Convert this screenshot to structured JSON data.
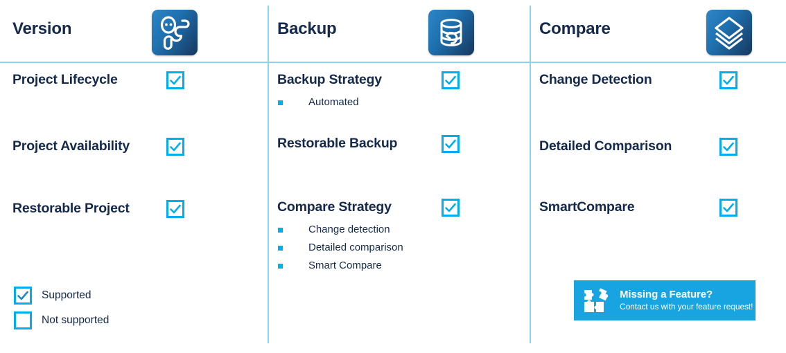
{
  "theme": {
    "accent": "#00aeef",
    "heading_color": "#14294b",
    "divider_color": "#8ad4f2",
    "banner_bg": "#18a4e0",
    "icon_gradient_from": "#2e86c5",
    "icon_gradient_to": "#17375e"
  },
  "columns": [
    {
      "title": "Version",
      "icon": "version-branch-icon",
      "rows": [
        {
          "label": "Project Lifecycle",
          "supported": true,
          "subitems": []
        },
        {
          "label": "Project Availability",
          "supported": true,
          "subitems": []
        },
        {
          "label": "Restorable Project",
          "supported": true,
          "subitems": []
        }
      ]
    },
    {
      "title": "Backup",
      "icon": "database-restore-icon",
      "rows": [
        {
          "label": "Backup Strategy",
          "supported": true,
          "subitems": [
            "Automated"
          ]
        },
        {
          "label": "Restorable Backup",
          "supported": true,
          "subitems": []
        },
        {
          "label": "Compare Strategy",
          "supported": true,
          "subitems": [
            "Change detection",
            "Detailed comparison",
            "Smart Compare"
          ]
        }
      ]
    },
    {
      "title": "Compare",
      "icon": "stacked-layers-icon",
      "rows": [
        {
          "label": "Change Detection",
          "supported": true,
          "subitems": []
        },
        {
          "label": "Detailed Comparison",
          "supported": true,
          "subitems": []
        },
        {
          "label": "SmartCompare",
          "supported": true,
          "subitems": []
        }
      ]
    }
  ],
  "legend": [
    {
      "label": "Supported",
      "checked": true
    },
    {
      "label": "Not supported",
      "checked": false
    }
  ],
  "banner": {
    "icon": "puzzle-pieces-icon",
    "title": "Missing a Feature?",
    "subtitle": "Contact us with your feature request!"
  }
}
